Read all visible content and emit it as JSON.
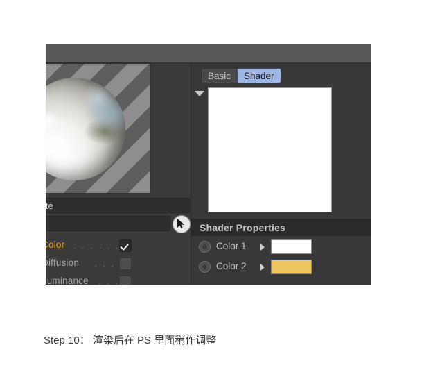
{
  "window": {
    "left_panel": {
      "preview_name": "material-preview-sphere",
      "name_field_value": "ite",
      "name_field_placeholder": "",
      "path_field_value": "",
      "cursor_tool_icon": "arrow-cursor-icon",
      "channels": [
        {
          "label": "Color",
          "dots": ". . . . . . .",
          "checked": true,
          "state": "active"
        },
        {
          "label": "Diffusion",
          "dots": ". . . .",
          "checked": false,
          "state": "inactive"
        },
        {
          "label": "Luminance",
          "dots": ". . . .",
          "checked": false,
          "state": "inactive"
        }
      ]
    },
    "right_panel": {
      "tabs": [
        {
          "label": "Basic",
          "active": false
        },
        {
          "label": "Shader",
          "active": true
        }
      ],
      "shader_preview_color": "#FFFFFF",
      "properties_title": "Shader Properties",
      "properties": [
        {
          "label": "Color 1",
          "swatch": "#FFFFFF"
        },
        {
          "label": "Color 2",
          "swatch": "#EFC75E"
        }
      ]
    }
  },
  "caption": {
    "text": "Step 10： 渲染后在 PS 里面稍作调整"
  },
  "colors": {
    "header_bar": "#585858",
    "panel_bg": "#383838",
    "band_bg": "#2A2A2A",
    "active_tab": "#9FB6E2",
    "accent_orange": "#F0A318",
    "gold_swatch": "#EFC75E"
  }
}
